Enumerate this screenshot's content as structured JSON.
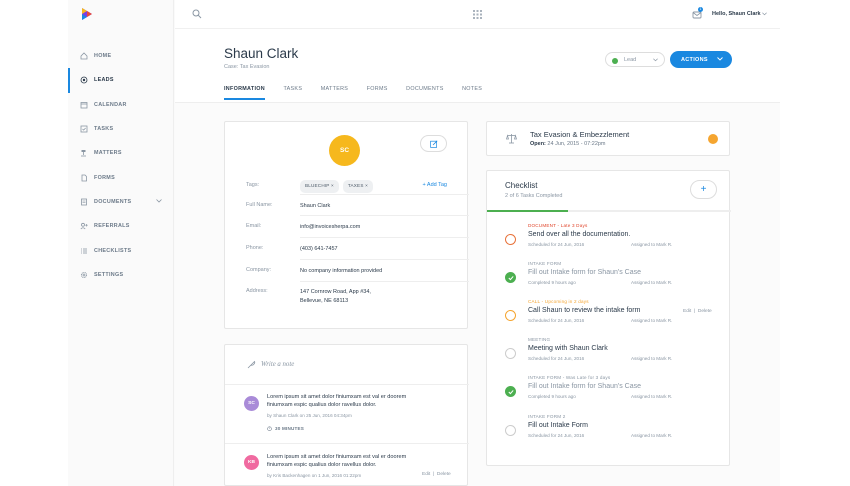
{
  "brand": {
    "logo_icon": "multicolor-play-logo-icon"
  },
  "sidebar": {
    "items": [
      {
        "label": "HOME",
        "icon": "home-icon"
      },
      {
        "label": "LEADS",
        "icon": "leads-icon",
        "active": true
      },
      {
        "label": "CALENDAR",
        "icon": "calendar-icon"
      },
      {
        "label": "TASKS",
        "icon": "tasks-icon"
      },
      {
        "label": "MATTERS",
        "icon": "gavel-icon"
      },
      {
        "label": "FORMS",
        "icon": "forms-icon"
      },
      {
        "label": "DOCUMENTS",
        "icon": "documents-icon"
      },
      {
        "label": "REFERRALS",
        "icon": "referrals-icon"
      },
      {
        "label": "CHECKLISTS",
        "icon": "checklist-icon"
      },
      {
        "label": "SETTINGS",
        "icon": "gear-icon"
      }
    ]
  },
  "topbar": {
    "greeting": "Hello, Shaun Clark",
    "notification_count": "1"
  },
  "header": {
    "name": "Shaun Clark",
    "case": "Case: Tax Evasion",
    "status_select": "Lead",
    "actions_label": "ACTIONS",
    "tabs": [
      "INFORMATION",
      "TASKS",
      "MATTERS",
      "FORMS",
      "DOCUMENTS",
      "NOTES"
    ]
  },
  "info": {
    "initials": "SC",
    "tags_label": "Tags:",
    "tags": [
      "BLUECHIP",
      "TAXES"
    ],
    "add_tag": "+ Add Tag",
    "full_name_label": "Full Name:",
    "full_name": "Shaun Clark",
    "email_label": "Email:",
    "email": "info@invoicesherpa.com",
    "phone_label": "Phone:",
    "phone": "(403) 641-7457",
    "company_label": "Company:",
    "company": "No company information provided",
    "address_label": "Address:",
    "address_line1": "147 Cornrow Road, App #34,",
    "address_line2": "Bellevue, NE 68113"
  },
  "case_card": {
    "title": "Tax Evasion & Embezzlement",
    "open_label": "Open:",
    "open_date": "24 Jun, 2015 - 07:22pm",
    "status_color": "#f5a530"
  },
  "checklist": {
    "title": "Checklist",
    "subtitle": "2 of 6 Tasks Completed",
    "add_label": "+",
    "progress": 0.333,
    "tasks": [
      {
        "category": "DOCUMENT - Late 3 Days",
        "title": "Send over all the documentation.",
        "meta": "Scheduled for 24 Jun, 2016",
        "assignee": "Assigned to Mark R.",
        "state": "late"
      },
      {
        "category": "INTAKE FORM",
        "title": "Fill out Intake form for Shaun's Case",
        "meta": "Completed 9 hours ago",
        "assignee": "Assigned to Mark R.",
        "state": "done"
      },
      {
        "category": "CALL - Upcoming in 2 days",
        "title": "Call Shaun to review the intake form",
        "meta": "Scheduled for 24 Jun, 2016",
        "assignee": "Assigned to Mark R.",
        "state": "upcoming",
        "edit": "Edit",
        "delete": "Delete"
      },
      {
        "category": "MEETING",
        "title": "Meeting with Shaun Clark",
        "meta": "Scheduled for 24 Jun, 2016",
        "assignee": "Assigned to Mark R.",
        "state": "open"
      },
      {
        "category": "INTAKE FORM - Was Late for 3 days",
        "title": "Fill out Intake form for Shaun's Case",
        "meta": "Completed 9 hours ago",
        "assignee": "Assigned to Mark R.",
        "state": "done"
      },
      {
        "category": "INTAKE FORM 2",
        "title": "Fill out Intake Form",
        "meta": "Scheduled for 24 Jun, 2016",
        "assignee": "Assigned to Mark R.",
        "state": "open"
      }
    ]
  },
  "notes": {
    "placeholder": "Write a note",
    "items": [
      {
        "initials": "SC",
        "avatar_color": "#a98bd8",
        "text": "Lorem ipsum sit amet dolor finiumxam est val er doorem finiumxam espic qualius dolor ravellus dolor.",
        "by": "by Shaun Clark on 25 Jun, 2016 04:34pm",
        "time": "30 MINUTES"
      },
      {
        "initials": "KB",
        "avatar_color": "#f06aa0",
        "text": "Lorem ipsum sit amet dolor finiumxam est val er doorem finiumxam espic qualius dolor ravellus dolor.",
        "by": "by Kris Backenhagen on 1 Jun, 2016 01:22pm",
        "edit": "Edit",
        "delete": "Delete"
      }
    ]
  }
}
